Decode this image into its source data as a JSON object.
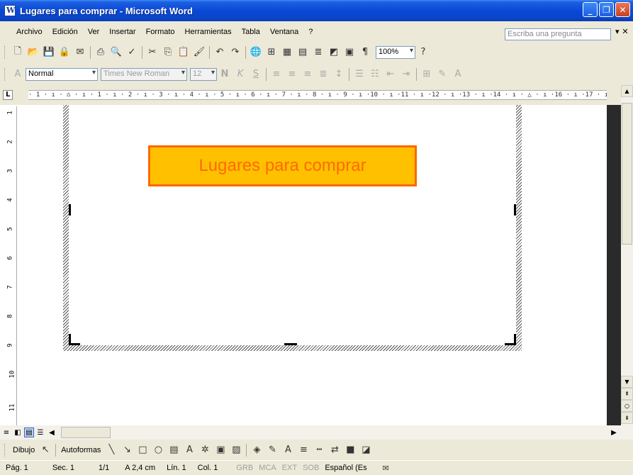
{
  "window": {
    "title": "Lugares para comprar - Microsoft Word",
    "buttons": [
      "_",
      "❐",
      "✕"
    ]
  },
  "menu": {
    "items": [
      "Archivo",
      "Edición",
      "Ver",
      "Insertar",
      "Formato",
      "Herramientas",
      "Tabla",
      "Ventana",
      "?"
    ],
    "ask_placeholder": "Escriba una pregunta",
    "close_glyph": "▾ ✕"
  },
  "standard_toolbar": {
    "zoom": "100%"
  },
  "format_toolbar": {
    "style": "Normal",
    "font": "Times New Roman",
    "size": "12"
  },
  "ruler": {
    "text": "· 1 · ı · ⌂ · ı · 1 · ı · 2 · ı · 3 · ı · 4 · ı · 5 · ı · 6 · ı · 7 · ı · 8 · ı · 9 · ı ·10 · ı ·11 · ı ·12 · ı ·13 · ı ·14 · ı · △ · ı ·16 · ı ·17 · ı ·"
  },
  "vertical_ruler": [
    "1",
    "2",
    "3",
    "4",
    "5",
    "6",
    "7",
    "8",
    "9",
    "10",
    "11"
  ],
  "document": {
    "title_box_text": "Lugares para comprar"
  },
  "drawing_toolbar": {
    "draw_label": "Dibujo",
    "autoshapes_label": "Autoformas"
  },
  "status": {
    "page": "Pág. 1",
    "section": "Sec. 1",
    "pages": "1/1",
    "position": "A 2,4 cm",
    "line": "Lín. 1",
    "column": "Col. 1",
    "grb": "GRB",
    "mca": "MCA",
    "ext": "EXT",
    "sob": "SOB",
    "language": "Español (Es"
  }
}
